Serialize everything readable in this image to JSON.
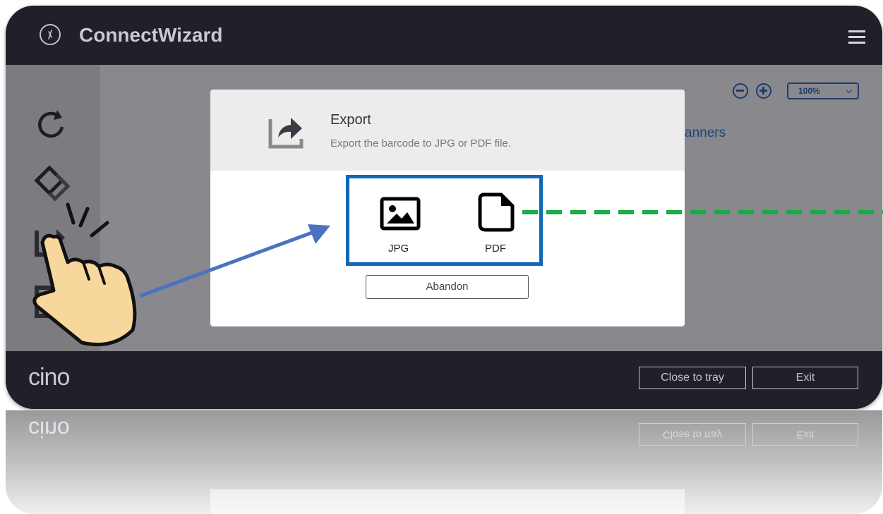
{
  "app": {
    "title": "ConnectWizard",
    "brand": "cino",
    "colors": {
      "titlebar": "#1f2028",
      "accent": "#1f4478",
      "highlight": "#0f68b5",
      "annotation_arrow": "#4b72c0",
      "annotation_dashes": "#1aaa46"
    }
  },
  "toolbar": {
    "zoom_value": "100%",
    "icons": [
      "minus-circle-icon",
      "plus-circle-icon",
      "chevron-down-icon"
    ]
  },
  "background": {
    "heading_partial": "anners"
  },
  "sidebar": {
    "icons": [
      "refresh-icon",
      "layers-icon",
      "export-icon",
      "document-icon"
    ]
  },
  "dialog": {
    "title": "Export",
    "subtitle": "Export the barcode to JPG or PDF file.",
    "options": [
      {
        "label": "JPG",
        "icon": "image-icon"
      },
      {
        "label": "PDF",
        "icon": "file-icon"
      }
    ],
    "abandon_label": "Abandon"
  },
  "footer": {
    "close_to_tray_label": "Close to tray",
    "exit_label": "Exit"
  }
}
